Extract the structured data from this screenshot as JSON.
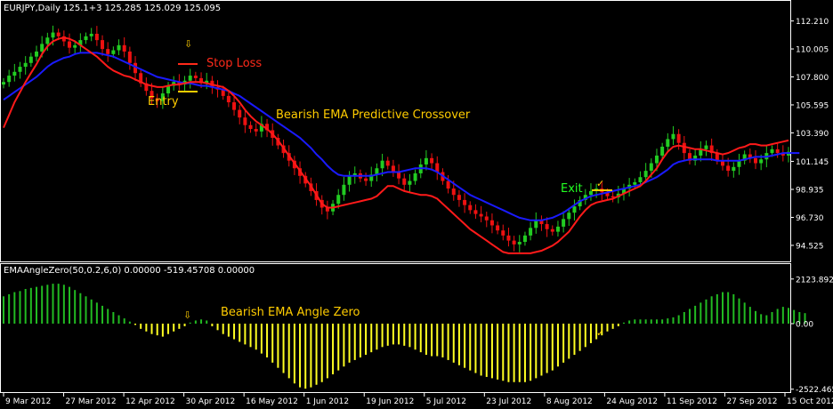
{
  "colors": {
    "background": "#000000",
    "frame": "#ffffff",
    "bull_candle": "#22cc22",
    "bear_candle": "#ee1111",
    "ema_fast": "#ff1a1a",
    "ema_slow": "#1a1aff",
    "hist_positive": "#22bb22",
    "hist_negative": "#ffff22",
    "annotation_text": "#ffcc00",
    "stop_loss": "#ff2a1a",
    "exit": "#22ff22",
    "marker": "#ffcc00"
  },
  "price_panel": {
    "header": "EURJPY,Daily  125.1+3 125.285 125.029 125.095",
    "annotations": {
      "stop_loss": "Stop Loss",
      "entry": "Entry",
      "crossover": "Bearish EMA Predictive Crossover",
      "exit": "Exit"
    }
  },
  "indicator_panel": {
    "header": "EMAAngleZero(50,0.2,6,0) 0.00000 -519.45708 0.00000",
    "annotation": "Bearish EMA Angle Zero"
  },
  "chart_data": [
    {
      "type": "candlestick",
      "symbol": "EURJPY",
      "timeframe": "Daily",
      "ylim": [
        93.4,
        112.6
      ],
      "y_ticks": [
        "112.210",
        "110.005",
        "107.800",
        "105.595",
        "103.390",
        "101.145",
        "98.935",
        "96.730",
        "94.525"
      ],
      "x_ticks": [
        "9 Mar 2012",
        "27 Mar 2012",
        "12 Apr 2012",
        "30 Apr 2012",
        "16 May 2012",
        "1 Jun 2012",
        "19 Jun 2012",
        "5 Jul 2012",
        "23 Jul 2012",
        "8 Aug 2012",
        "24 Aug 2012",
        "11 Sep 2012",
        "27 Sep 2012",
        "15 Oct 2012"
      ],
      "closes": [
        107.4,
        107.9,
        108.2,
        108.6,
        108.9,
        109.4,
        109.8,
        110.4,
        110.9,
        111.3,
        111.0,
        110.6,
        110.1,
        110.3,
        110.7,
        111.0,
        111.2,
        110.7,
        110.0,
        109.6,
        109.9,
        110.3,
        109.8,
        108.9,
        108.1,
        107.3,
        106.7,
        106.1,
        105.9,
        106.5,
        107.1,
        107.4,
        107.2,
        107.5,
        107.9,
        107.7,
        107.3,
        107.5,
        107.0,
        106.8,
        106.3,
        105.8,
        105.2,
        104.6,
        104.0,
        103.7,
        103.5,
        104.1,
        103.6,
        103.0,
        102.4,
        101.8,
        101.2,
        100.6,
        100.0,
        99.4,
        98.8,
        98.1,
        97.5,
        97.2,
        97.8,
        98.5,
        99.3,
        100.0,
        100.2,
        99.8,
        99.6,
        100.1,
        100.6,
        101.2,
        100.8,
        100.3,
        99.8,
        99.3,
        99.6,
        100.2,
        100.9,
        101.4,
        101.0,
        100.3,
        99.6,
        99.0,
        98.5,
        98.1,
        97.7,
        97.3,
        97.0,
        96.8,
        96.5,
        96.1,
        95.7,
        95.3,
        94.9,
        94.6,
        94.8,
        95.3,
        95.9,
        96.5,
        96.2,
        95.8,
        95.6,
        96.0,
        96.6,
        97.1,
        97.6,
        98.1,
        98.5,
        98.8,
        99.0,
        98.7,
        98.4,
        98.3,
        98.6,
        99.0,
        99.3,
        99.5,
        99.9,
        100.4,
        101.0,
        101.6,
        102.3,
        102.9,
        103.3,
        102.6,
        101.8,
        101.2,
        101.6,
        102.1,
        102.4,
        101.8,
        101.2,
        100.8,
        100.4,
        100.7,
        101.2,
        101.7,
        101.4,
        101.0,
        101.3,
        101.8,
        102.1,
        101.8,
        101.6,
        101.9
      ],
      "ema_fast": [
        103.8,
        104.8,
        105.8,
        106.6,
        107.4,
        108.1,
        108.8,
        109.6,
        110.2,
        110.6,
        110.8,
        110.9,
        110.8,
        110.6,
        110.3,
        110.0,
        109.7,
        109.4,
        109.0,
        108.6,
        108.3,
        108.1,
        107.9,
        107.8,
        107.6,
        107.4,
        107.2,
        107.1,
        107.0,
        107.0,
        107.1,
        107.2,
        107.2,
        107.3,
        107.4,
        107.4,
        107.4,
        107.3,
        107.2,
        107.1,
        107.0,
        106.7,
        106.3,
        105.8,
        105.2,
        104.7,
        104.3,
        104.0,
        103.7,
        103.3,
        102.8,
        102.2,
        101.6,
        101.0,
        100.4,
        99.8,
        99.2,
        98.5,
        97.8,
        97.5,
        97.5,
        97.6,
        97.7,
        97.8,
        97.9,
        98.0,
        98.1,
        98.2,
        98.4,
        98.8,
        99.2,
        99.2,
        99.0,
        98.8,
        98.7,
        98.6,
        98.5,
        98.5,
        98.4,
        98.2,
        97.8,
        97.4,
        97.0,
        96.6,
        96.2,
        95.8,
        95.5,
        95.2,
        94.9,
        94.6,
        94.3,
        94.0,
        93.9,
        93.9,
        93.9,
        93.9,
        93.9,
        94.0,
        94.1,
        94.3,
        94.5,
        94.8,
        95.2,
        95.6,
        96.2,
        96.8,
        97.3,
        97.7,
        97.9,
        98.0,
        98.1,
        98.2,
        98.4,
        98.6,
        98.8,
        99.0,
        99.2,
        99.6,
        100.1,
        100.6,
        101.3,
        101.9,
        102.3,
        102.4,
        102.3,
        102.2,
        102.1,
        102.1,
        102.0,
        101.9,
        101.8,
        101.7,
        101.8,
        102.0,
        102.2,
        102.3,
        102.5,
        102.5,
        102.4,
        102.4,
        102.5,
        102.6,
        102.7,
        102.8
      ],
      "ema_slow": [
        106.0,
        106.3,
        106.6,
        106.9,
        107.2,
        107.5,
        107.8,
        108.2,
        108.6,
        108.9,
        109.1,
        109.3,
        109.4,
        109.6,
        109.7,
        109.7,
        109.7,
        109.7,
        109.6,
        109.5,
        109.4,
        109.2,
        109.0,
        108.8,
        108.6,
        108.4,
        108.2,
        108.0,
        107.8,
        107.7,
        107.6,
        107.5,
        107.4,
        107.3,
        107.3,
        107.2,
        107.1,
        107.1,
        107.0,
        106.9,
        106.8,
        106.7,
        106.5,
        106.3,
        106.0,
        105.7,
        105.4,
        105.1,
        104.8,
        104.5,
        104.2,
        103.9,
        103.6,
        103.3,
        103.0,
        102.6,
        102.2,
        101.7,
        101.3,
        100.8,
        100.4,
        100.1,
        100.0,
        100.0,
        100.0,
        100.0,
        100.0,
        100.0,
        100.1,
        100.2,
        100.3,
        100.3,
        100.3,
        100.4,
        100.5,
        100.6,
        100.6,
        100.6,
        100.5,
        100.3,
        100.0,
        99.7,
        99.4,
        99.1,
        98.8,
        98.5,
        98.3,
        98.1,
        97.9,
        97.7,
        97.5,
        97.3,
        97.1,
        96.9,
        96.7,
        96.6,
        96.5,
        96.5,
        96.5,
        96.6,
        96.7,
        96.9,
        97.1,
        97.4,
        97.7,
        98.0,
        98.2,
        98.4,
        98.5,
        98.6,
        98.7,
        98.8,
        98.9,
        99.0,
        99.1,
        99.2,
        99.3,
        99.5,
        99.7,
        99.9,
        100.2,
        100.5,
        100.9,
        101.1,
        101.2,
        101.3,
        101.3,
        101.3,
        101.3,
        101.3,
        101.2,
        101.2,
        101.2,
        101.2,
        101.2,
        101.3,
        101.4,
        101.5,
        101.5,
        101.5,
        101.6,
        101.7,
        101.8,
        101.8,
        101.8,
        101.8
      ]
    },
    {
      "type": "bar",
      "name": "EMAAngleZero",
      "ylim": [
        -2600,
        2200
      ],
      "y_ticks": [
        "2123.8923",
        "0.00",
        "-2522.4650"
      ],
      "values": [
        1300,
        1400,
        1500,
        1550,
        1650,
        1700,
        1750,
        1800,
        1850,
        1900,
        1900,
        1850,
        1750,
        1600,
        1450,
        1300,
        1150,
        1000,
        850,
        700,
        550,
        400,
        250,
        100,
        -50,
        -200,
        -300,
        -400,
        -450,
        -500,
        -400,
        -300,
        -200,
        -100,
        50,
        150,
        200,
        150,
        -100,
        -250,
        -400,
        -500,
        -600,
        -700,
        -800,
        -900,
        -1000,
        -1150,
        -1300,
        -1500,
        -1700,
        -1900,
        -2100,
        -2300,
        -2450,
        -2500,
        -2450,
        -2350,
        -2250,
        -2100,
        -1950,
        -1800,
        -1650,
        -1500,
        -1400,
        -1300,
        -1200,
        -1100,
        -1000,
        -900,
        -850,
        -800,
        -800,
        -850,
        -900,
        -1000,
        -1100,
        -1200,
        -1250,
        -1250,
        -1300,
        -1400,
        -1500,
        -1600,
        -1700,
        -1800,
        -1900,
        -2000,
        -2050,
        -2100,
        -2150,
        -2200,
        -2250,
        -2250,
        -2250,
        -2250,
        -2200,
        -2100,
        -2000,
        -1900,
        -1800,
        -1650,
        -1500,
        -1350,
        -1200,
        -1050,
        -900,
        -750,
        -600,
        -450,
        -300,
        -200,
        -100,
        50,
        150,
        200,
        200,
        200,
        200,
        200,
        200,
        250,
        300,
        400,
        550,
        700,
        850,
        1000,
        1150,
        1300,
        1400,
        1500,
        1500,
        1400,
        1200,
        1000,
        800,
        600,
        450,
        400,
        550,
        700,
        800,
        750,
        650,
        550,
        500
      ]
    }
  ]
}
